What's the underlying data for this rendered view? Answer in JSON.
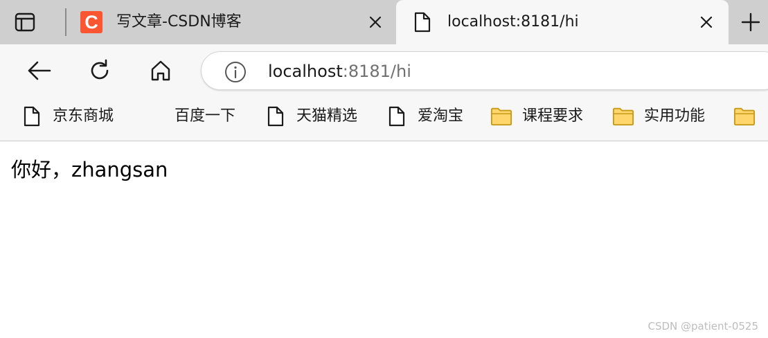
{
  "tabs": [
    {
      "title": "写文章-CSDN博客",
      "favicon": "csdn-logo-icon",
      "favicon_letter": "C",
      "active": false
    },
    {
      "title": "localhost:8181/hi",
      "favicon": "page-icon",
      "active": true
    }
  ],
  "toolbar": {
    "url_host": "localhost",
    "url_rest": ":8181/hi"
  },
  "bookmarks": [
    {
      "label": "京东商城",
      "icon": "page-icon"
    },
    {
      "label": "百度一下",
      "icon": "none"
    },
    {
      "label": "天猫精选",
      "icon": "page-icon"
    },
    {
      "label": "爱淘宝",
      "icon": "page-icon"
    },
    {
      "label": "课程要求",
      "icon": "folder-icon"
    },
    {
      "label": "实用功能",
      "icon": "folder-icon"
    },
    {
      "label": "",
      "icon": "folder-icon"
    }
  ],
  "page": {
    "greeting": "你好，zhangsan"
  },
  "watermark": "CSDN @patient-0525",
  "colors": {
    "tabstrip": "#cfcfcf",
    "toolbar": "#f7f7f7",
    "csdn_brand": "#fc5531",
    "folder_fill": "#ffd66b",
    "folder_stroke": "#c59a1a"
  }
}
